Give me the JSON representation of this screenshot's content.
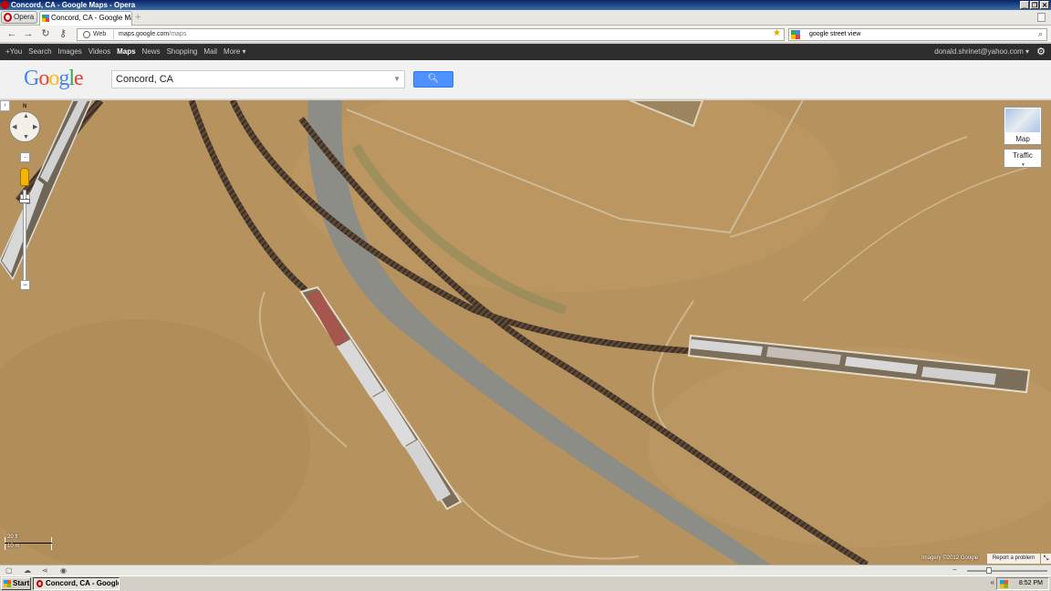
{
  "window": {
    "title": "Concord, CA - Google Maps - Opera"
  },
  "browser": {
    "menu_label": "Opera",
    "tab_title": "Concord, CA - Google Maps",
    "address_scheme_label": "Web",
    "address_host": "maps.google.com",
    "address_path": "/maps",
    "search_engine_query": "google street view"
  },
  "google_bar": {
    "links": [
      "+You",
      "Search",
      "Images",
      "Videos",
      "Maps",
      "News",
      "Shopping",
      "Mail",
      "More ▾"
    ],
    "active_link": "Maps",
    "account": "donald.shrinet@yahoo.com ▾"
  },
  "search": {
    "logo": "Google",
    "query": "Concord, CA"
  },
  "map_controls": {
    "compass_label": "N",
    "map_type_label": "Map",
    "traffic_label": "Traffic",
    "scale_top": "20 ft",
    "scale_bottom": "10 m",
    "imagery_credit": "Imagery ©2012 Google",
    "report_label": "Report a problem"
  },
  "taskbar": {
    "start_label": "Start",
    "task_label": "Concord, CA - Google ...",
    "clock": "8:52 PM"
  },
  "colors": {
    "terrain": "#b6925e",
    "road": "#8d8d88",
    "track": "#4a3a2c",
    "google_blue": "#4285f4",
    "google_red": "#ea4335",
    "google_yellow": "#fbbc05",
    "google_green": "#34a853"
  }
}
